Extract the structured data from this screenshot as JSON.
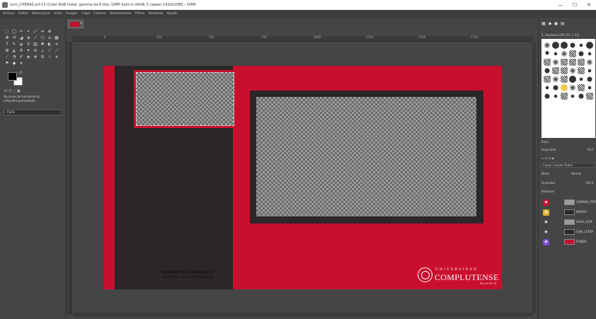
{
  "window": {
    "title": "ucm_CHERAS.xcf-13 (Color RGB lineal, gamma de 8 bits, GIMP built-in sRGB, 5 capas) 1920x1080 – GIMP",
    "minimize": "—",
    "maximize": "☐",
    "close": "✕"
  },
  "menu": [
    "Archivo",
    "Editar",
    "Seleccionar",
    "Vista",
    "Imagen",
    "Capa",
    "Colores",
    "Herramientas",
    "Filtros",
    "Ventanas",
    "Ayuda"
  ],
  "toolbox": {
    "tools": [
      "⬚",
      "◯",
      "✂",
      "⌖",
      "⤢",
      "⇔",
      "⊕",
      "⬛",
      "✥",
      "⟲",
      "◢",
      "⬗",
      "⟋",
      "⬡",
      "⌂",
      "▦",
      "T",
      "✎",
      "⬙",
      "⚲",
      "▥",
      "✚",
      "◐",
      "⌗",
      "⊞",
      "◭",
      "A",
      "✦",
      "≋",
      "⟂",
      "⁄",
      "⟋",
      "⟋",
      "◔",
      "✐",
      "◈",
      "⬘",
      "⊟",
      "⟊",
      "⚹",
      "⚑",
      "◆",
      "▾"
    ],
    "swap_glyph": "⇄",
    "mini_icons": "⊡ ↺ ⬚ ▣",
    "options_title": "Opciones de herramienta",
    "options_label": "▸ Muestra promediada",
    "select_value": "Radio",
    "select_arrow": "⌄"
  },
  "canvas": {
    "tab_close": "x",
    "ruler_labels": [
      "0",
      "250",
      "500",
      "750",
      "1000",
      "1250",
      "1500",
      "1750"
    ],
    "footer_title": "FACULTAD DE CIENCIAS DE LA",
    "footer_line": "UNIVERSIDAD COMPLUTENSE DE MADRID",
    "logo": {
      "top": "UNIVERSIDAD",
      "name": "COMPLUTENSE",
      "bottom": "MADRID"
    }
  },
  "dock": {
    "icons": "▦ ◆ ◼ ▤",
    "brush_title": "2. Hardness 050 (51 × 51)",
    "filter_label": "Basic,",
    "spacing_label": "Espaciado",
    "spacing_value": "10.0",
    "layers_tabs": "Capas  Canales  Rutas",
    "mode_label": "Modo",
    "mode_value": "Normal",
    "opacity_label": "Opacidad",
    "opacity_value": "100.0",
    "lock_label": "Bloquear:",
    "layers": [
      {
        "name": "CAMARA_FOTO",
        "eye_color": "#c8102e",
        "thumb_color": "#9a9a9a"
      },
      {
        "name": "MARCO",
        "eye_color": "#e0b030",
        "thumb_color": "#2b2627"
      },
      {
        "name": "LOGO_UCM",
        "eye_color": "#454545",
        "thumb_color": "#9a9a9a"
      },
      {
        "name": "CAJA_LETRA",
        "eye_color": "#454545",
        "thumb_color": "#2b2627"
      },
      {
        "name": "FONDO",
        "eye_color": "#7a4bd6",
        "thumb_color": "#c8102e"
      }
    ]
  },
  "colors": {
    "accent_red": "#c8102e",
    "dark_panel": "#2b2627"
  }
}
